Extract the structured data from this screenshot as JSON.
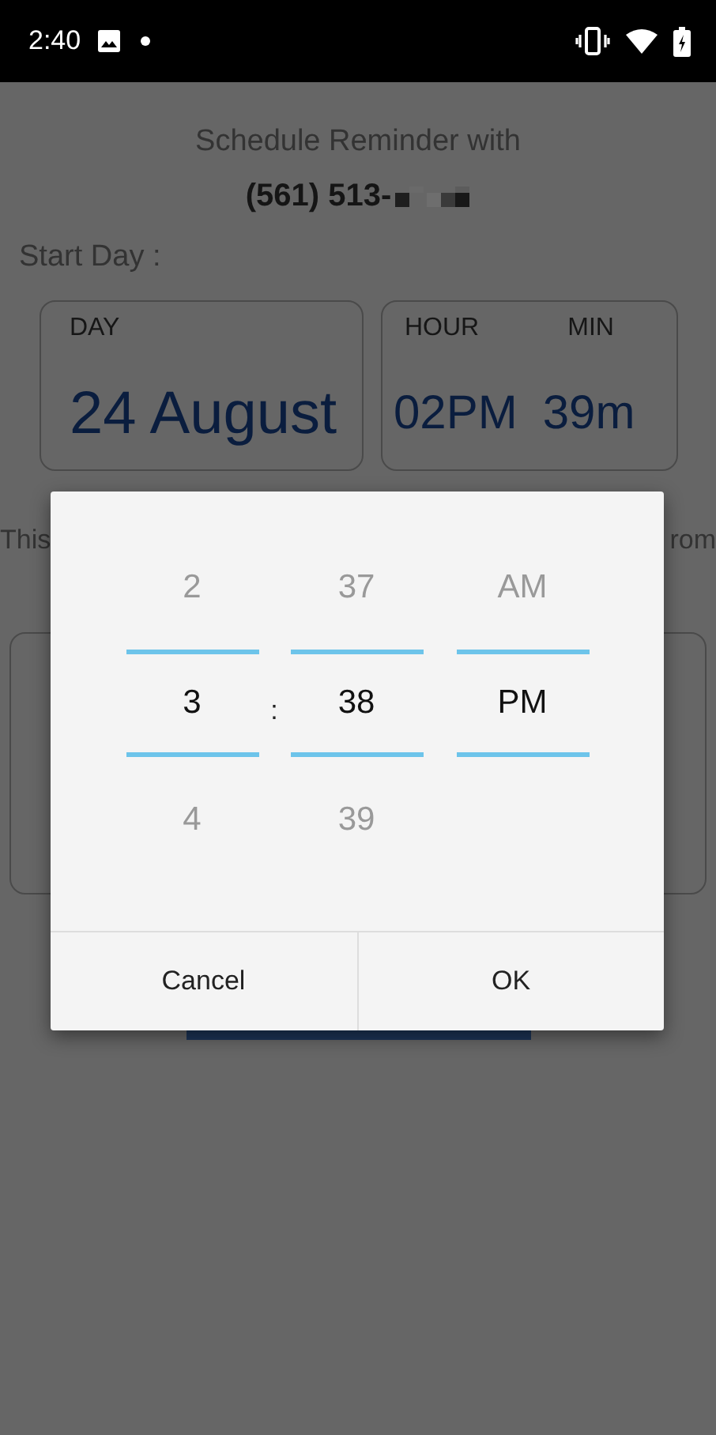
{
  "status_bar": {
    "time": "2:40"
  },
  "header": {
    "title": "Schedule Reminder with",
    "phone": "(561) 513-"
  },
  "start_day": {
    "label": "Start Day :"
  },
  "day_card": {
    "label": "DAY",
    "value": "24 August"
  },
  "time_card": {
    "hour_label": "HOUR",
    "min_label": "MIN",
    "hour_value": "02PM",
    "min_value": "39m"
  },
  "note": {
    "left": "This",
    "right": "rom"
  },
  "time_picker": {
    "separator": ":",
    "columns": [
      {
        "items": [
          {
            "label": "2",
            "selected": false
          },
          {
            "label": "3",
            "selected": true
          },
          {
            "label": "4",
            "selected": false
          }
        ]
      },
      {
        "items": [
          {
            "label": "37",
            "selected": false
          },
          {
            "label": "38",
            "selected": true
          },
          {
            "label": "39",
            "selected": false
          }
        ]
      },
      {
        "items": [
          {
            "label": "AM",
            "selected": false
          },
          {
            "label": "PM",
            "selected": true
          }
        ]
      }
    ],
    "buttons": [
      "Cancel",
      "OK"
    ]
  }
}
